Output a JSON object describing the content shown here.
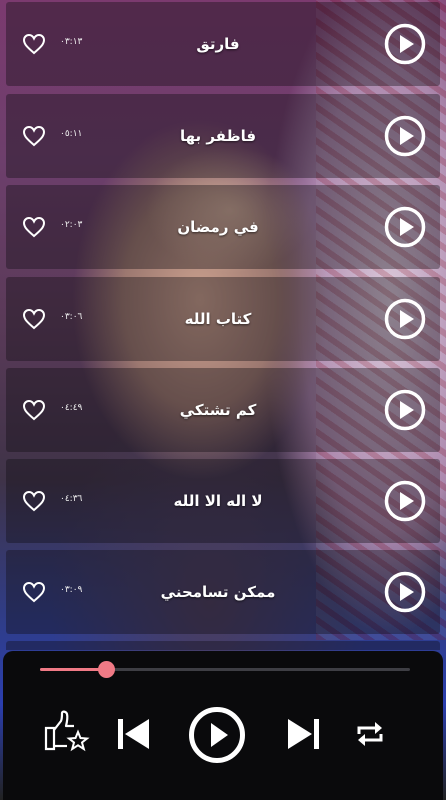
{
  "tracks": [
    {
      "title": "فارتق",
      "duration": "٠٣:١٣"
    },
    {
      "title": "فاظفر بها",
      "duration": "٠٥:١١"
    },
    {
      "title": "في رمضان",
      "duration": "٠٢:٠٣"
    },
    {
      "title": "كتاب الله",
      "duration": "٠٣:٠٦"
    },
    {
      "title": "كم تشتكي",
      "duration": "٠٤:٤٩"
    },
    {
      "title": "لا اله الا الله",
      "duration": "٠٤:٣٦"
    },
    {
      "title": "ممكن تسامحني",
      "duration": "٠٣:٠٩"
    }
  ],
  "player": {
    "progress": 0.18,
    "controls": [
      "rate-app-icon",
      "previous-icon",
      "play-icon",
      "next-icon",
      "repeat-icon"
    ]
  },
  "colors": {
    "accent": "#f07a86",
    "player_bg": "#0a0a0c",
    "row_bg": "rgba(15,12,18,0.38)"
  }
}
